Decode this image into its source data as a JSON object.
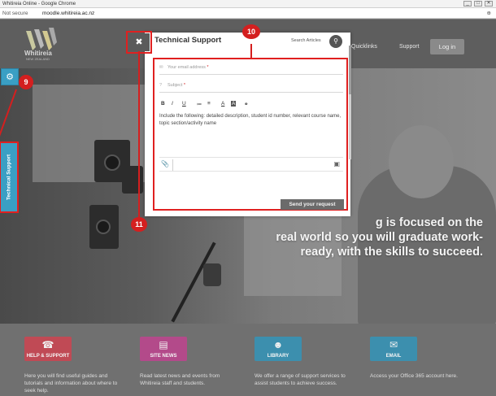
{
  "browser": {
    "title": "Whitireia Online - Google Chrome",
    "security": "Not secure",
    "url": "moodle.whitireia.ac.nz",
    "zoom_icon": "zoom-icon",
    "win_min": "_",
    "win_max": "□",
    "win_close": "✕"
  },
  "nav": {
    "logo_text": "Whitireia",
    "logo_sub": "NEW ZEALAND",
    "quicklinks": "Quicklinks",
    "support": "Support",
    "login": "Log in"
  },
  "hero": {
    "line1": "g is focused on the",
    "line2": "real world so you will graduate work-",
    "line3": "ready, with the skills to succeed."
  },
  "cards": [
    {
      "label": "HELP & SUPPORT",
      "color": "#c04a55",
      "glyph": "☎",
      "text": "Here you will find useful guides and tutorials and information about where to seek help."
    },
    {
      "label": "SITE NEWS",
      "color": "#b34a8a",
      "glyph": "▤",
      "text": "Read latest news and events from Whitireia staff and students."
    },
    {
      "label": "LIBRARY",
      "color": "#3c8fae",
      "glyph": "☻",
      "text": "We offer a range of support services to assist students to achieve success."
    },
    {
      "label": "EMAIL",
      "color": "#3c8fae",
      "glyph": "✉",
      "text": "Access your Office 365 account here."
    }
  ],
  "support_tab": {
    "label": "Technical Support",
    "gear_icon": "⚙"
  },
  "modal": {
    "title": "Technical Support",
    "search_label": "Search Articles",
    "search_icon": "🔍",
    "close_icon": "✖",
    "email_placeholder": "Your email address",
    "subject_placeholder": "Subject",
    "required_mark": "*",
    "toolbar": {
      "bold": "B",
      "italic": "I",
      "underline": "U",
      "bullets": "≔",
      "numbers": "≡",
      "font_color": "A",
      "bg_color": "A",
      "link": "⚭"
    },
    "message": "Include the following: detailed description, student id number, relevant course name, topic section/activity name",
    "attach_icon": "📎",
    "screenshot_icon": "▣",
    "send": "Send your request"
  },
  "markers": {
    "m9": "9",
    "m10": "10",
    "m11": "11"
  }
}
